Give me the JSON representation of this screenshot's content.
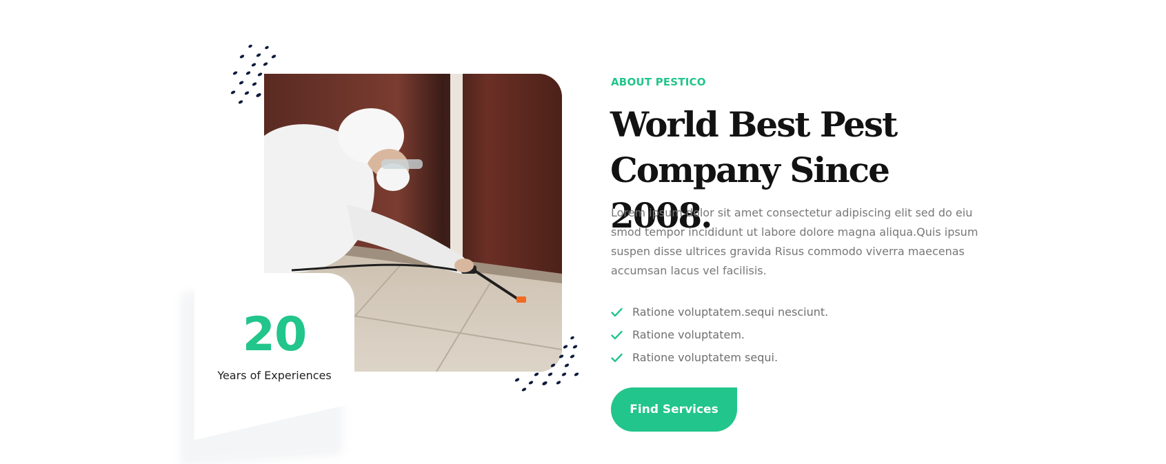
{
  "about": {
    "eyebrow": "ABOUT PESTICO",
    "heading_line1": "World Best Pest",
    "heading_line2": "Company Since 2008.",
    "body": "Lorem ipsum dolor sit amet consectetur adipiscing elit sed do eiu smod tempor incididunt ut labore dolore magna aliqua.Quis ipsum suspen disse ultrices gravida Risus commodo viverra maecenas accumsan lacus vel facilisis.",
    "features": [
      "Ratione voluptatem.sequi nesciunt.",
      "Ratione voluptatem.",
      "Ratione voluptatem sequi."
    ],
    "cta_label": "Find Services"
  },
  "experience": {
    "number": "20",
    "label": "Years of Experiences"
  },
  "icons": {
    "check": "check-icon",
    "dots": "dot-pattern-icon"
  },
  "colors": {
    "accent": "#22c58b",
    "heading": "#121212",
    "body": "#777777",
    "dots": "#0e1b3d"
  }
}
